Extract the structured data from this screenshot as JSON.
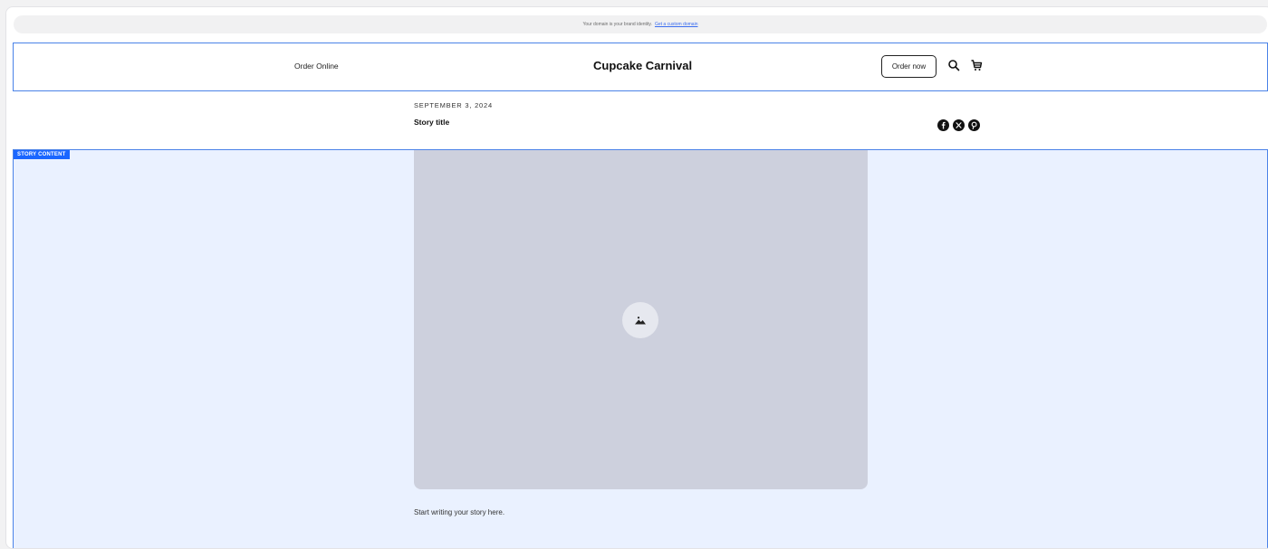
{
  "domain_notice": {
    "text": "Your domain is your brand identity.",
    "link": "Get a custom domain"
  },
  "header": {
    "nav_link": "Order Online",
    "brand": "Cupcake Carnival",
    "order_button": "Order now",
    "icons": [
      "search-icon",
      "cart-icon"
    ]
  },
  "story": {
    "date": "SEPTEMBER 3, 2024",
    "title": "Story title",
    "social_icons": [
      "facebook-icon",
      "x-icon",
      "pinterest-icon"
    ],
    "content_tag": "STORY CONTENT",
    "body": "Start writing your story here."
  },
  "colors": {
    "selection_outline": "#4a82e8",
    "content_bg": "#eaf1ff",
    "tag_bg": "#1a66ff",
    "placeholder_bg": "#cdd0dd"
  }
}
